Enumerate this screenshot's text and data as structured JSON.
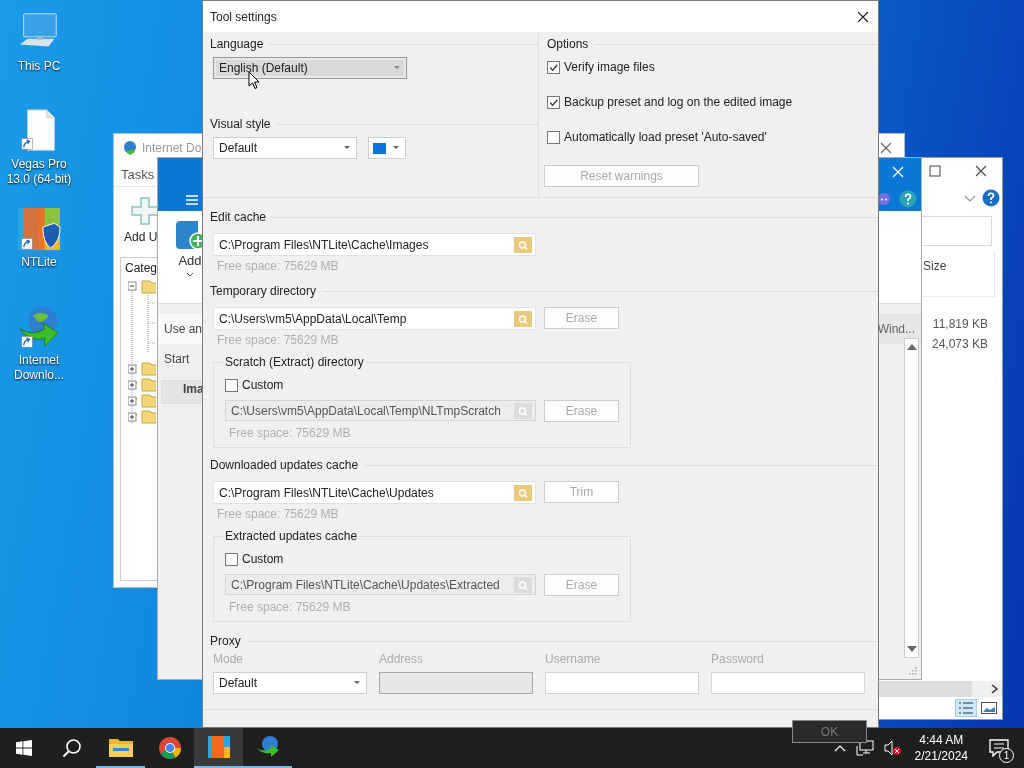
{
  "desktop_icons": [
    {
      "label": "This PC",
      "kind": "pc"
    },
    {
      "label": "Vegas Pro 13.0 (64-bit)",
      "kind": "file"
    },
    {
      "label": "NTLite",
      "kind": "ntlite"
    },
    {
      "label": "Internet Downlo...",
      "kind": "idm"
    }
  ],
  "idm_window": {
    "title": "Internet Do",
    "menu": "Tasks",
    "toolbar_button": "Add U",
    "tree_header": "Categ"
  },
  "ntlite_window": {
    "toolbar_button": "Add",
    "rows": [
      {
        "kind": "item",
        "cells": [
          "Use an",
          "Wind..."
        ]
      },
      {
        "kind": "item",
        "cells": [
          "Start"
        ]
      },
      {
        "kind": "group",
        "cells": [
          "Ima"
        ]
      }
    ]
  },
  "explorer_window": {
    "column_header": "Size",
    "rows": [
      {
        "size": "11,819 KB"
      },
      {
        "size": "24,073 KB"
      }
    ]
  },
  "dialog": {
    "title": "Tool settings",
    "language": {
      "label": "Language",
      "value": "English (Default)",
      "highlighted": true
    },
    "visual_style": {
      "label": "Visual style",
      "value": "Default"
    },
    "options": {
      "label": "Options",
      "items": [
        {
          "label": "Verify image files",
          "checked": true
        },
        {
          "label": "Backup preset and log on the edited image",
          "checked": true
        },
        {
          "label": "Automatically load preset 'Auto-saved'",
          "checked": false
        }
      ],
      "reset_button": {
        "label": "Reset warnings",
        "disabled": true
      }
    },
    "sections": [
      {
        "label": "Edit cache",
        "path": "C:\\Program Files\\NTLite\\Cache\\Images",
        "free_space": "Free space: 75629 MB"
      },
      {
        "label": "Temporary directory",
        "path": "C:\\Users\\vm5\\AppData\\Local\\Temp",
        "button": {
          "label": "Erase",
          "disabled": true
        },
        "free_space": "Free space: 75629 MB",
        "group": {
          "label": "Scratch (Extract) directory",
          "custom": {
            "label": "Custom",
            "checked": false
          },
          "path": "C:\\Users\\vm5\\AppData\\Local\\Temp\\NLTmpScratch",
          "button": {
            "label": "Erase",
            "disabled": true
          },
          "free_space": "Free space: 75629 MB"
        }
      },
      {
        "label": "Downloaded updates cache",
        "path": "C:\\Program Files\\NTLite\\Cache\\Updates",
        "button": {
          "label": "Trim",
          "disabled": true
        },
        "free_space": "Free space: 75629 MB",
        "group": {
          "label": "Extracted updates cache",
          "custom": {
            "label": "Custom",
            "checked": false
          },
          "path": "C:\\Program Files\\NTLite\\Cache\\Updates\\Extracted",
          "button": {
            "label": "Erase",
            "disabled": true
          },
          "free_space": "Free space: 75629 MB"
        }
      }
    ],
    "proxy": {
      "label": "Proxy",
      "fields": [
        {
          "label": "Mode",
          "kind": "dropdown",
          "value": "Default",
          "disabled": false
        },
        {
          "label": "Address",
          "kind": "text",
          "disabled": true
        },
        {
          "label": "Username",
          "kind": "text",
          "disabled": false
        },
        {
          "label": "Password",
          "kind": "text",
          "disabled": false
        }
      ]
    },
    "ok_button": "OK"
  },
  "taskbar": {
    "apps": [
      {
        "kind": "folder",
        "running": true,
        "active": false
      },
      {
        "kind": "chrome",
        "running": false,
        "active": false
      },
      {
        "kind": "ntlite",
        "running": true,
        "active": true
      },
      {
        "kind": "idm",
        "running": true,
        "active": false
      }
    ],
    "time": "4:44 AM",
    "date": "2/21/2024",
    "notifications": "1"
  }
}
